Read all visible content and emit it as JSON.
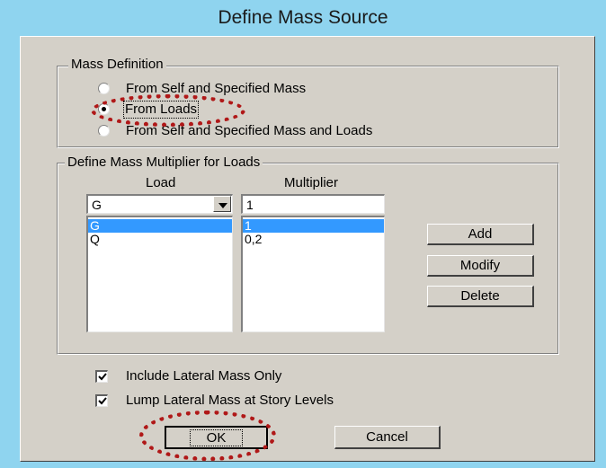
{
  "window": {
    "title": "Define Mass Source"
  },
  "mass_definition": {
    "legend": "Mass Definition",
    "options": [
      {
        "label": "From Self and Specified Mass",
        "selected": false
      },
      {
        "label": "From Loads",
        "selected": true
      },
      {
        "label": "From Self and Specified Mass and Loads",
        "selected": false
      }
    ]
  },
  "multiplier_group": {
    "legend": "Define Mass Multiplier for Loads",
    "load_header": "Load",
    "multiplier_header": "Multiplier",
    "load_value": "G",
    "multiplier_value": "1",
    "load_items": [
      "G",
      "Q"
    ],
    "multiplier_items": [
      "1",
      "0,2"
    ],
    "buttons": {
      "add": "Add",
      "modify": "Modify",
      "delete": "Delete"
    }
  },
  "checkboxes": [
    {
      "label": "Include Lateral Mass Only",
      "checked": true
    },
    {
      "label": "Lump Lateral Mass at Story Levels",
      "checked": true
    }
  ],
  "footer": {
    "ok": "OK",
    "cancel": "Cancel"
  },
  "colors": {
    "title_bar": "#8fd4ef",
    "dialog": "#d4d0c8",
    "selection": "#3399ff",
    "annotation": "#b01818"
  }
}
